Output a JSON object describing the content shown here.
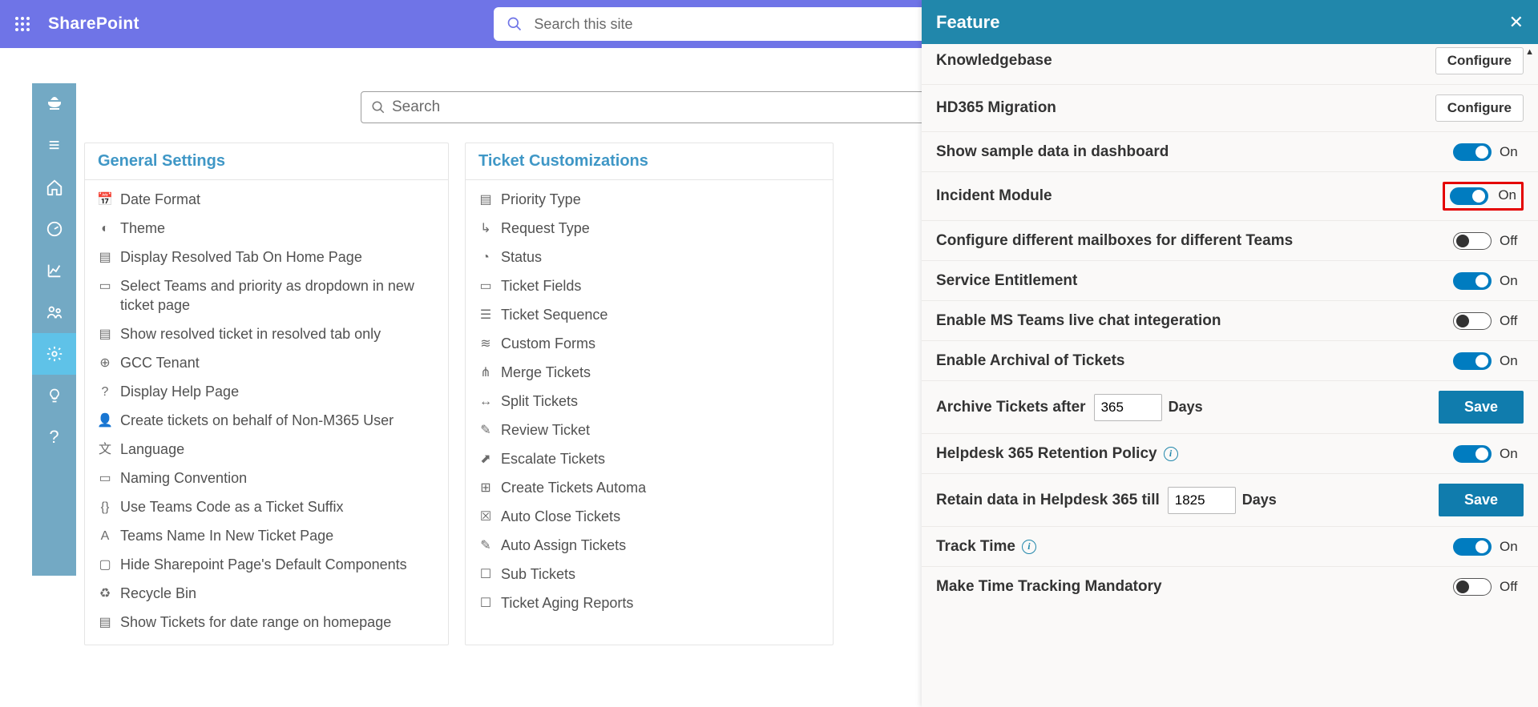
{
  "header": {
    "app_title": "SharePoint",
    "search_placeholder": "Search this site"
  },
  "content_search_placeholder": "Search",
  "cards": {
    "general": {
      "title": "General Settings",
      "items": [
        "Date Format",
        "Theme",
        "Display Resolved Tab On Home Page",
        "Select Teams and priority as dropdown in new ticket page",
        "Show resolved ticket in resolved tab only",
        "GCC Tenant",
        "Display Help Page",
        "Create tickets on behalf of Non-M365 User",
        "Language",
        "Naming Convention",
        "Use Teams Code as a Ticket Suffix",
        "Teams Name In New Ticket Page",
        "Hide Sharepoint Page's Default Components",
        "Recycle Bin",
        "Show Tickets for date range on homepage"
      ]
    },
    "ticket": {
      "title": "Ticket Customizations",
      "items": [
        "Priority Type",
        "Request Type",
        "Status",
        "Ticket Fields",
        "Ticket Sequence",
        "Custom Forms",
        "Merge Tickets",
        "Split Tickets",
        "Review Ticket",
        "Escalate Tickets",
        "Create Tickets Automa",
        "Auto Close Tickets",
        "Auto Assign Tickets",
        "Sub Tickets",
        "Ticket Aging Reports"
      ]
    }
  },
  "panel": {
    "title": "Feature",
    "configure_label": "Configure",
    "save_label": "Save",
    "days_label": "Days",
    "on_label": "On",
    "off_label": "Off",
    "rows": {
      "knowledgebase": "Knowledgebase",
      "migration": "HD365 Migration",
      "sample_data": "Show sample data in dashboard",
      "incident": "Incident Module",
      "mailboxes": "Configure different mailboxes for different Teams",
      "entitlement": "Service Entitlement",
      "teams_chat": "Enable MS Teams live chat integeration",
      "archival": "Enable Archival of Tickets",
      "archive_after": "Archive Tickets after",
      "retention": "Helpdesk 365 Retention Policy",
      "retain_till": "Retain data in Helpdesk 365 till",
      "track_time": "Track Time",
      "mandatory": "Make Time Tracking Mandatory"
    },
    "values": {
      "archive_days": "365",
      "retain_days": "1825"
    }
  }
}
